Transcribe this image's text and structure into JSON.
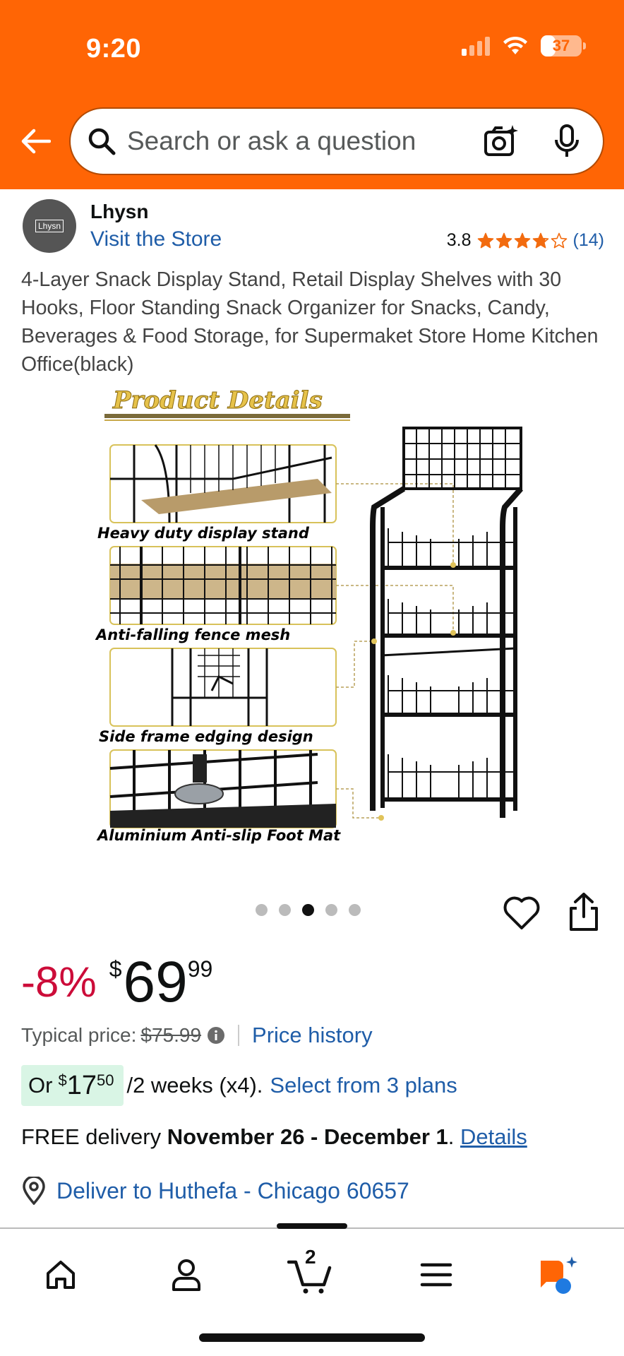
{
  "colors": {
    "accent": "#ff6505",
    "link": "#1f5da8",
    "discount": "#cc0c39",
    "star": "#f26b0f",
    "installment_bg": "#d9f5e5"
  },
  "status_bar": {
    "time": "9:20",
    "battery": "37",
    "signal_bars_active": 1,
    "wifi_icon": "wifi-icon"
  },
  "header": {
    "back_icon": "back-arrow-icon",
    "search_placeholder": "Search or ask a question",
    "camera_icon": "camera-search-icon",
    "mic_icon": "microphone-icon"
  },
  "brand": {
    "logo_text": "Lhysn",
    "name": "Lhysn",
    "store_link": "Visit the Store"
  },
  "rating": {
    "value": "3.8",
    "stars": 3.8,
    "count": "(14)"
  },
  "product": {
    "title": "4-Layer Snack Display Stand, Retail Display Shelves with 30 Hooks, Floor Standing Snack Organizer for Snacks, Candy, Beverages & Food Storage, for Supermaket Store Home Kitchen Office(black)",
    "image": {
      "heading": "Product Details",
      "callouts": [
        "Heavy duty display stand",
        "Anti-falling fence mesh",
        "Side frame edging design",
        "Aluminium Anti-slip Foot Mat"
      ]
    },
    "carousel": {
      "count": 5,
      "active_index": 2
    }
  },
  "actions": {
    "favorite_icon": "heart-icon",
    "share_icon": "share-icon"
  },
  "pricing": {
    "discount": "-8%",
    "currency": "$",
    "whole": "69",
    "fraction": "99",
    "typical_label": "Typical price:",
    "typical_price": "$75.99",
    "price_history": "Price history"
  },
  "installment": {
    "prefix": "Or",
    "currency": "$",
    "whole": "17",
    "fraction": "50",
    "rest": "/2 weeks (x4).",
    "link": "Select from 3 plans"
  },
  "delivery": {
    "prefix": "FREE delivery",
    "dates": "November 26 - December 1",
    "period": ".",
    "details": "Details"
  },
  "deliver_to": {
    "text": "Deliver to Huthefa - Chicago 60657",
    "icon": "location-pin-icon"
  },
  "bottom_nav": {
    "items": [
      "home-icon",
      "account-icon",
      "cart-icon",
      "menu-icon",
      "rufus-ai-icon"
    ],
    "cart_count": "2"
  }
}
